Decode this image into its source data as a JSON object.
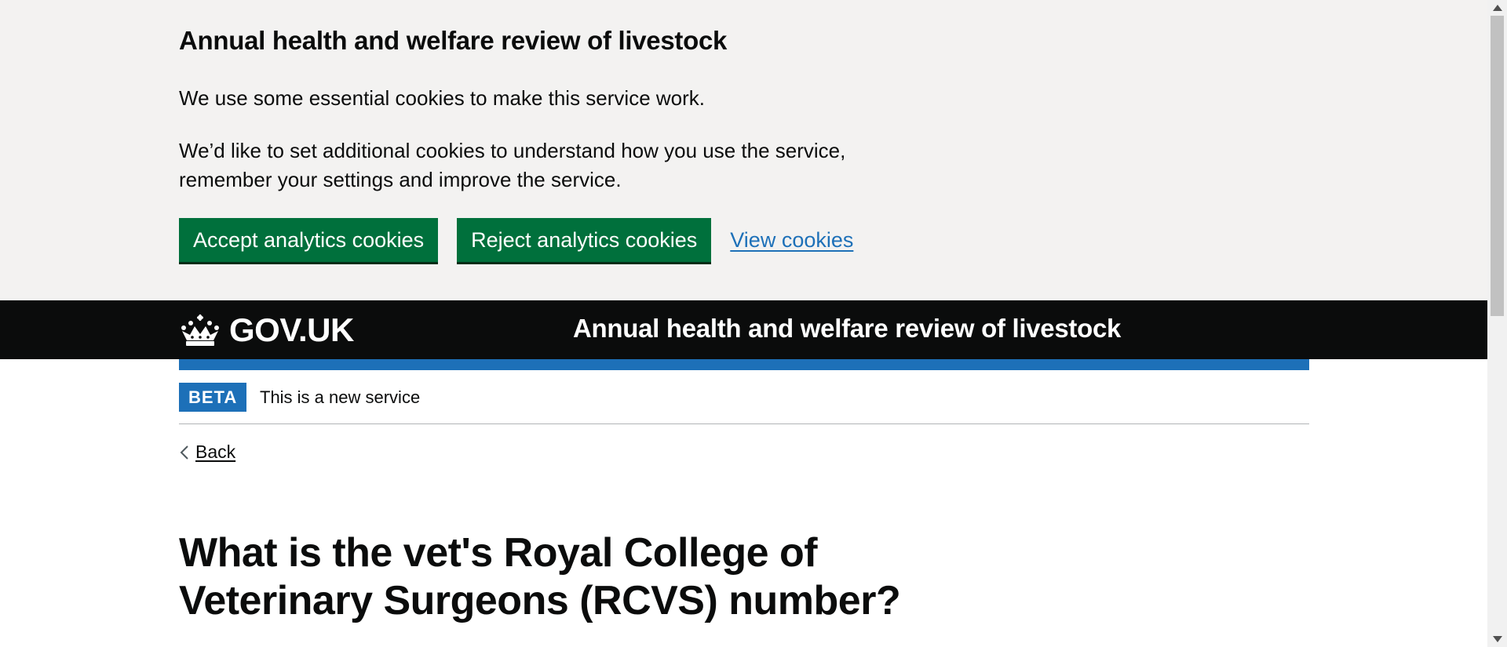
{
  "cookie_banner": {
    "heading": "Annual health and welfare review of livestock",
    "paragraph_1": "We use some essential cookies to make this service work.",
    "paragraph_2": "We’d like to set additional cookies to understand how you use the service, remember your settings and improve the service.",
    "accept_label": "Accept analytics cookies",
    "reject_label": "Reject analytics cookies",
    "view_label": "View cookies"
  },
  "header": {
    "logo_icon": "crown-icon",
    "logo_text": "GOV.UK",
    "service_name": "Annual health and welfare review of livestock"
  },
  "phase_banner": {
    "tag": "BETA",
    "text": "This is a new service"
  },
  "back_link": {
    "icon": "chevron-left-icon",
    "label": "Back"
  },
  "main": {
    "heading": "What is the vet's Royal College of Veterinary Surgeons (RCVS) number?"
  },
  "colors": {
    "banner_background": "#f3f2f1",
    "button_green": "#00703c",
    "link_blue": "#1d70b8",
    "header_black": "#0b0c0c",
    "phase_tag_blue": "#1d70b8"
  }
}
